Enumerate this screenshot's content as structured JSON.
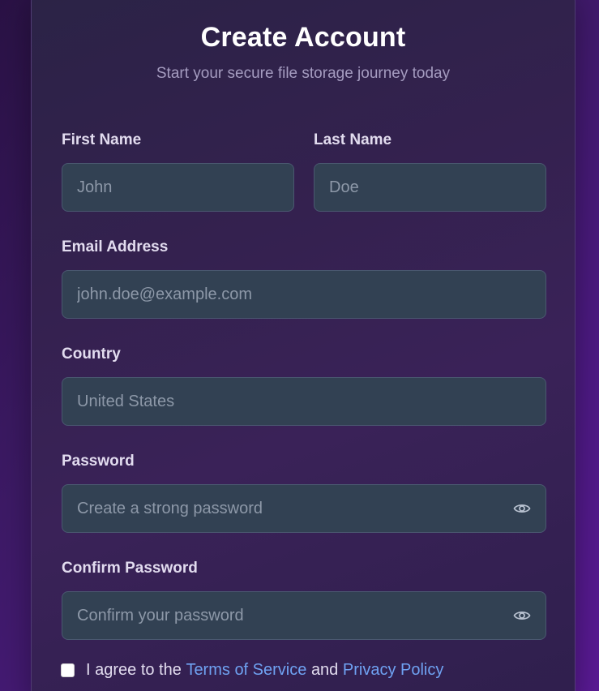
{
  "form": {
    "title": "Create Account",
    "subtitle": "Start your secure file storage journey today",
    "first_name": {
      "label": "First Name",
      "placeholder": "John"
    },
    "last_name": {
      "label": "Last Name",
      "placeholder": "Doe"
    },
    "email": {
      "label": "Email Address",
      "placeholder": "john.doe@example.com"
    },
    "country": {
      "label": "Country",
      "placeholder": "United States"
    },
    "password": {
      "label": "Password",
      "placeholder": "Create a strong password"
    },
    "confirm_password": {
      "label": "Confirm Password",
      "placeholder": "Confirm your password"
    },
    "terms": {
      "prefix": "I agree to the",
      "terms_link": "Terms of Service",
      "conjunction": "and",
      "privacy_link": "Privacy Policy",
      "checked": false
    }
  },
  "icons": {
    "password_toggle": "eye-icon",
    "confirm_password_toggle": "eye-icon"
  },
  "colors": {
    "link": "#6fa2f2",
    "field_background": "#324153",
    "card_background": "#33214f"
  }
}
